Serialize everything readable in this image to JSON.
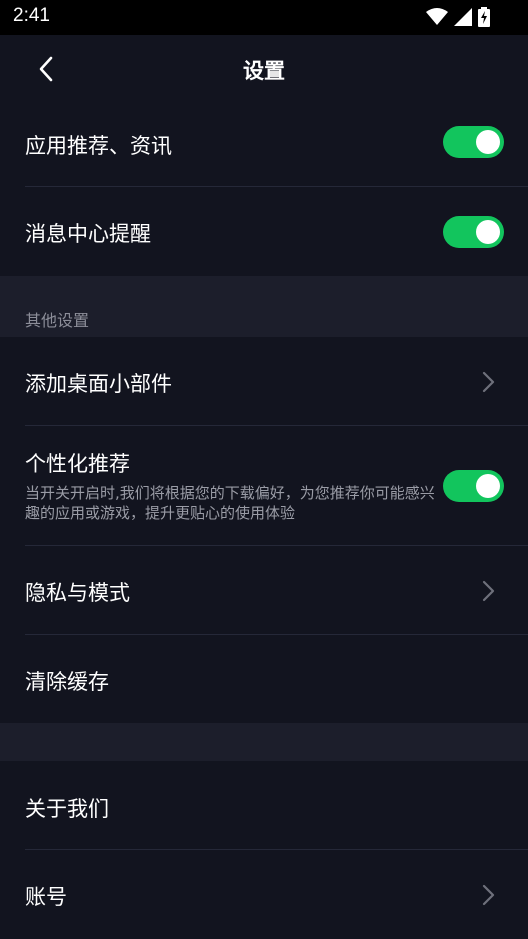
{
  "status_bar": {
    "time": "2:41"
  },
  "header": {
    "title": "设置"
  },
  "settings": {
    "app_recommend_label": "应用推荐、资讯",
    "app_recommend_on": true,
    "message_center_label": "消息中心提醒",
    "message_center_on": true
  },
  "other_section": {
    "title": "其他设置",
    "add_widget_label": "添加桌面小部件",
    "personalized_label": "个性化推荐",
    "personalized_desc": "当开关开启时,我们将根据您的下载偏好，为您推荐你可能感兴趣的应用或游戏，提升更贴心的使用体验",
    "personalized_on": true,
    "privacy_label": "隐私与模式",
    "clear_cache_label": "清除缓存"
  },
  "about_section": {
    "about_label": "关于我们",
    "account_label": "账号"
  },
  "colors": {
    "background": "#0f111c",
    "toggle_on": "#12c55d",
    "section_bg": "#1c1e2b"
  },
  "icons": {
    "back": "back-arrow-icon",
    "chevron": "chevron-right-icon",
    "wifi": "wifi-icon",
    "signal": "signal-icon",
    "battery": "battery-charging-icon"
  }
}
